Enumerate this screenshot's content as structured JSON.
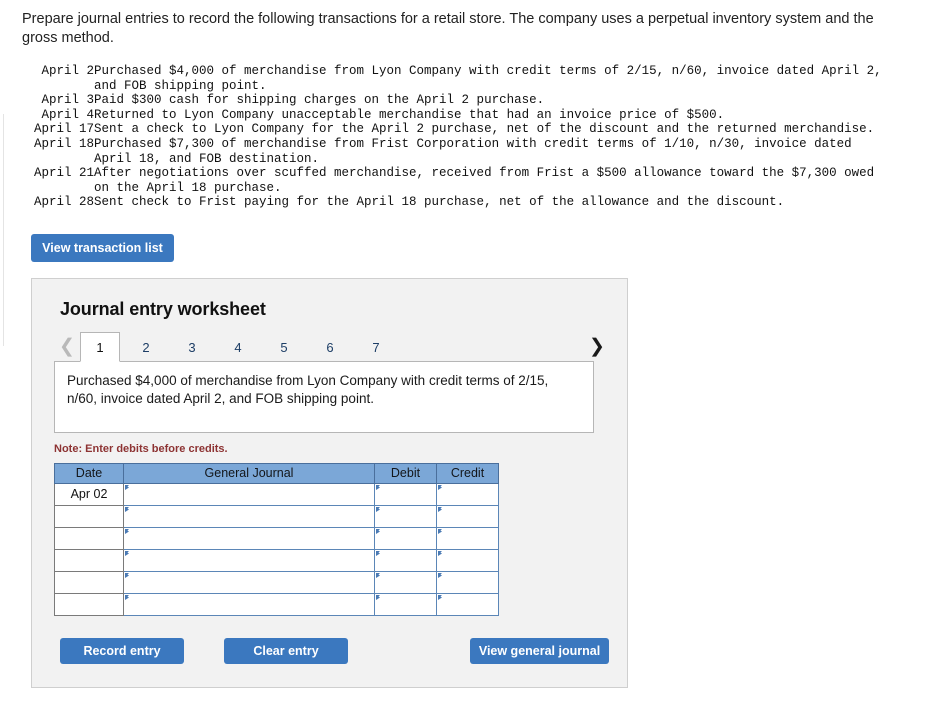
{
  "intro": {
    "text": "Prepare journal entries to record the following transactions for a retail store. The company uses a perpetual inventory system and the gross method."
  },
  "transactions": [
    {
      "date": "April 2",
      "description": "Purchased $4,000 of merchandise from Lyon Company with credit terms of 2/15, n/60, invoice dated April 2, and FOB shipping point."
    },
    {
      "date": "April 3",
      "description": "Paid $300 cash for shipping charges on the April 2 purchase."
    },
    {
      "date": "April 4",
      "description": "Returned to Lyon Company unacceptable merchandise that had an invoice price of $500."
    },
    {
      "date": "April 17",
      "description": "Sent a check to Lyon Company for the April 2 purchase, net of the discount and the returned merchandise."
    },
    {
      "date": "April 18",
      "description": "Purchased $7,300 of merchandise from Frist Corporation with credit terms of 1/10, n/30, invoice dated April 18, and FOB destination."
    },
    {
      "date": "April 21",
      "description": "After negotiations over scuffed merchandise, received from Frist a $500 allowance toward the $7,300 owed on the April 18 purchase."
    },
    {
      "date": "April 28",
      "description": "Sent check to Frist paying for the April 18 purchase, net of the allowance and the discount."
    }
  ],
  "toolbar": {
    "view_transaction_list_label": "View transaction list"
  },
  "worksheet": {
    "title": "Journal entry worksheet",
    "prev_icon": "chevron-left",
    "next_icon": "chevron-right",
    "tabs": [
      {
        "label": "1",
        "active": true
      },
      {
        "label": "2",
        "active": false
      },
      {
        "label": "3",
        "active": false
      },
      {
        "label": "4",
        "active": false
      },
      {
        "label": "5",
        "active": false
      },
      {
        "label": "6",
        "active": false
      },
      {
        "label": "7",
        "active": false
      }
    ],
    "description": "Purchased $4,000 of merchandise from Lyon Company with credit terms of 2/15, n/60, invoice dated April 2, and FOB shipping point.",
    "note": "Note: Enter debits before credits.",
    "table": {
      "headers": [
        "Date",
        "General Journal",
        "Debit",
        "Credit"
      ],
      "rows": [
        {
          "date": "Apr 02",
          "general_journal": "",
          "debit": "",
          "credit": ""
        },
        {
          "date": "",
          "general_journal": "",
          "debit": "",
          "credit": ""
        },
        {
          "date": "",
          "general_journal": "",
          "debit": "",
          "credit": ""
        },
        {
          "date": "",
          "general_journal": "",
          "debit": "",
          "credit": ""
        },
        {
          "date": "",
          "general_journal": "",
          "debit": "",
          "credit": ""
        },
        {
          "date": "",
          "general_journal": "",
          "debit": "",
          "credit": ""
        }
      ]
    },
    "footer": {
      "record_label": "Record entry",
      "clear_label": "Clear entry",
      "view_journal_label": "View general journal"
    }
  },
  "colors": {
    "button_blue": "#3b78bf",
    "table_header_blue": "#7ba7d7",
    "panel_gray": "#f2f2f2",
    "note_red": "#8d3333",
    "input_border_blue": "#5b86b7"
  }
}
